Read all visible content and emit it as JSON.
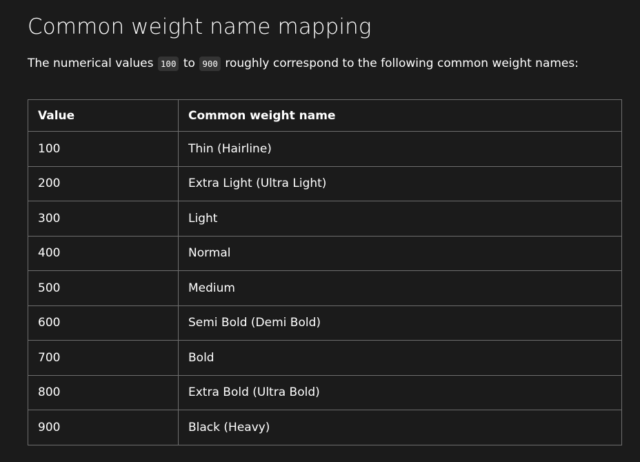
{
  "heading": "Common weight name mapping",
  "intro": {
    "before": "The numerical values ",
    "code_start": "100",
    "middle": " to ",
    "code_end": "900",
    "after": " roughly correspond to the following common weight names:"
  },
  "table": {
    "headers": [
      "Value",
      "Common weight name"
    ],
    "rows": [
      {
        "value": "100",
        "name": "Thin (Hairline)"
      },
      {
        "value": "200",
        "name": "Extra Light (Ultra Light)"
      },
      {
        "value": "300",
        "name": "Light"
      },
      {
        "value": "400",
        "name": "Normal"
      },
      {
        "value": "500",
        "name": "Medium"
      },
      {
        "value": "600",
        "name": "Semi Bold (Demi Bold)"
      },
      {
        "value": "700",
        "name": "Bold"
      },
      {
        "value": "800",
        "name": "Extra Bold (Ultra Bold)"
      },
      {
        "value": "900",
        "name": "Black (Heavy)"
      }
    ]
  }
}
